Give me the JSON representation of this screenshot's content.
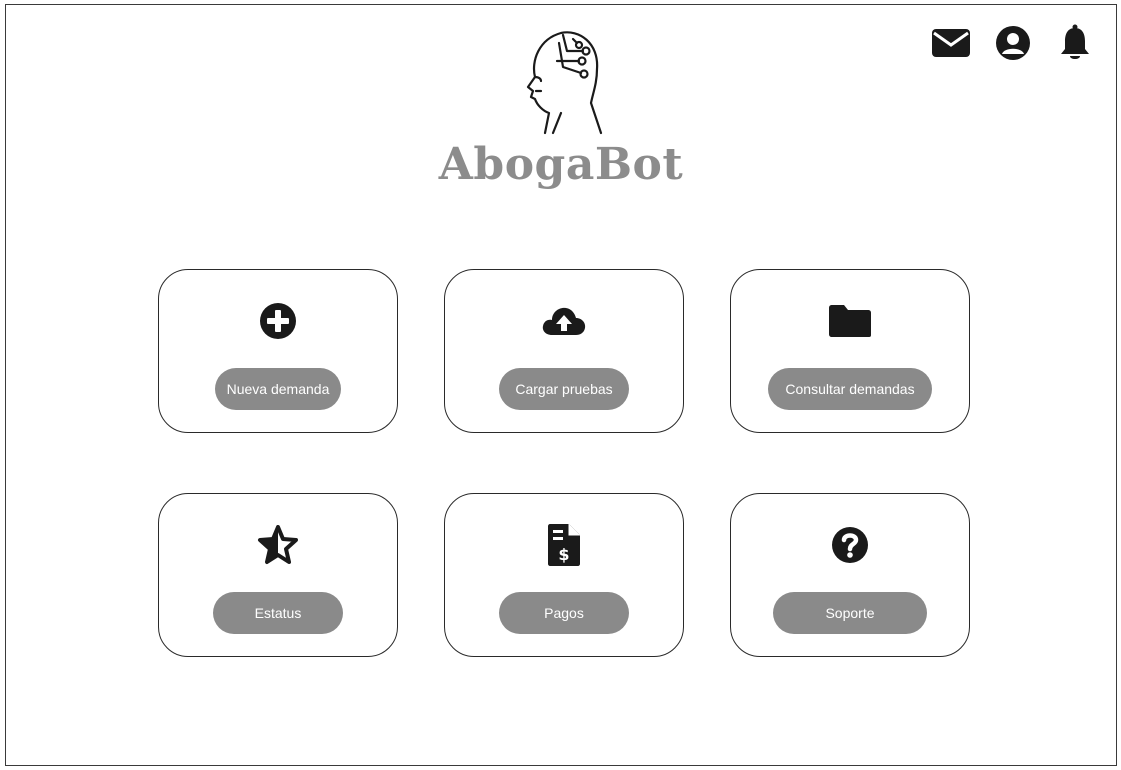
{
  "brand": {
    "name": "AbogaBot",
    "logo_icon": "ai-head-circuit-icon",
    "color": "#8c8c8c"
  },
  "header_icons": [
    {
      "name": "mail-icon"
    },
    {
      "name": "user-account-icon"
    },
    {
      "name": "bell-icon"
    }
  ],
  "cards": [
    {
      "label": "Nueva demanda",
      "icon": "plus-circle-icon"
    },
    {
      "label": "Cargar pruebas",
      "icon": "cloud-upload-icon"
    },
    {
      "label": "Consultar demandas",
      "icon": "folder-icon"
    },
    {
      "label": "Estatus",
      "icon": "half-star-icon"
    },
    {
      "label": "Pagos",
      "icon": "invoice-dollar-icon"
    },
    {
      "label": "Soporte",
      "icon": "question-circle-icon"
    }
  ],
  "colors": {
    "pill_bg": "#8a8a8a",
    "icon": "#1a1a1a",
    "border": "#2a2a2a"
  }
}
